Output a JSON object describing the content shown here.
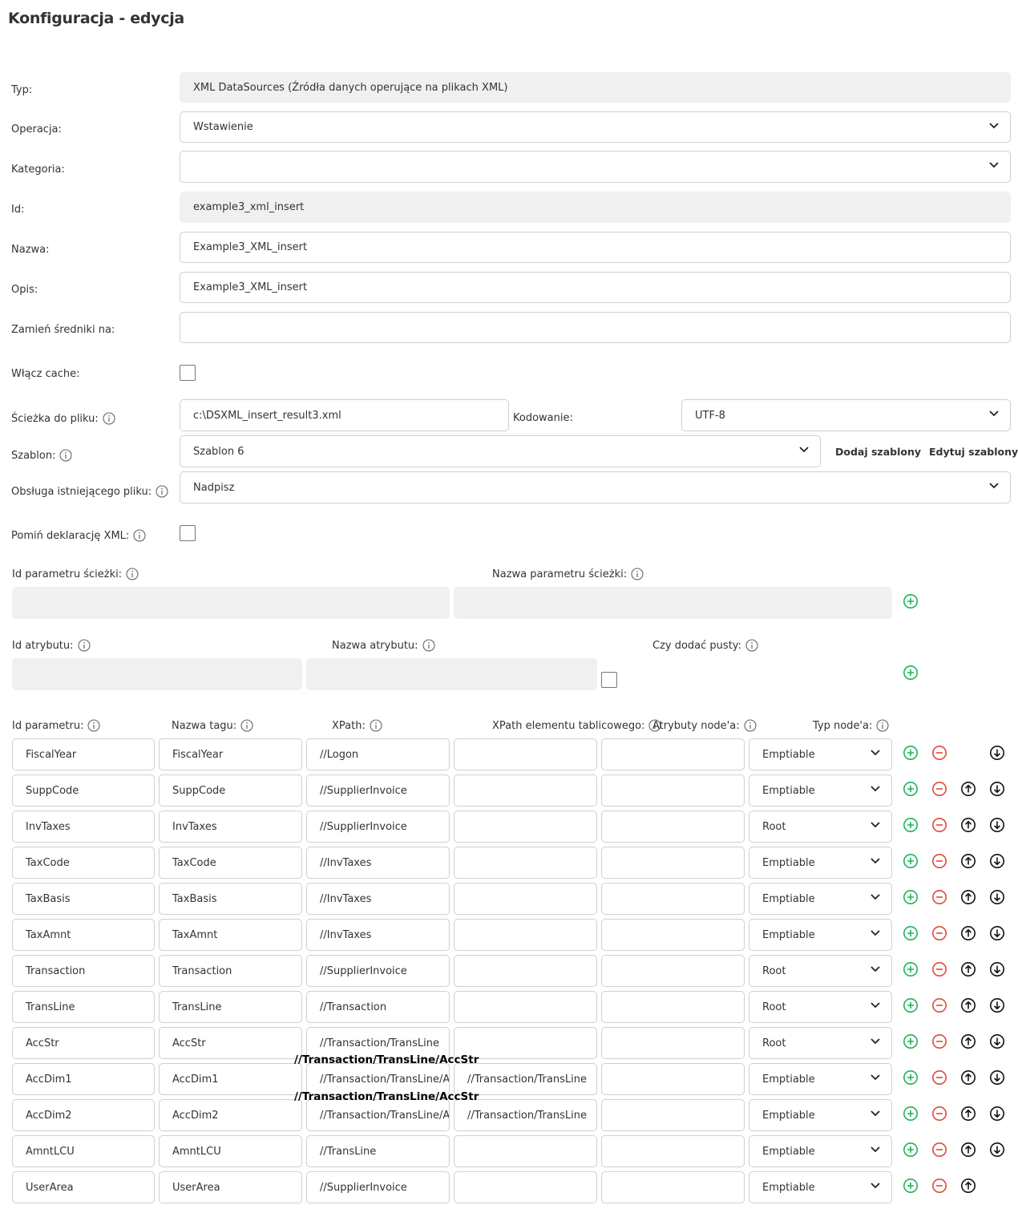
{
  "page": {
    "title": "Konfiguracja - edycja"
  },
  "form": {
    "typ": {
      "label": "Typ:",
      "value": "XML DataSources (Źródła danych operujące na plikach XML)"
    },
    "operacja": {
      "label": "Operacja:",
      "value": "Wstawienie"
    },
    "kategoria": {
      "label": "Kategoria:",
      "value": ""
    },
    "id": {
      "label": "Id:",
      "value": "example3_xml_insert"
    },
    "nazwa": {
      "label": "Nazwa:",
      "value": "Example3_XML_insert"
    },
    "opis": {
      "label": "Opis:",
      "value": "Example3_XML_insert"
    },
    "zamien": {
      "label": "Zamień średniki na:",
      "value": ""
    },
    "cache": {
      "label": "Włącz cache:",
      "checked": false
    },
    "sciezka": {
      "label": "Ścieżka do pliku:",
      "value": "c:\\DSXML_insert_result3.xml"
    },
    "kodowanie": {
      "label": "Kodowanie:",
      "value": "UTF-8"
    },
    "szablon": {
      "label": "Szablon:",
      "value": "Szablon 6",
      "add_label": "Dodaj szablony",
      "edit_label": "Edytuj szablony"
    },
    "obsluga": {
      "label": "Obsługa istniejącego pliku:",
      "value": "Nadpisz"
    },
    "pomin": {
      "label": "Pomiń deklarację XML:",
      "checked": false
    }
  },
  "path_params": {
    "id_label": "Id parametru ścieżki:",
    "name_label": "Nazwa parametru ścieżki:",
    "id_value": "",
    "name_value": ""
  },
  "attributes": {
    "id_label": "Id atrybutu:",
    "name_label": "Nazwa atrybutu:",
    "empty_label": "Czy dodać pusty:",
    "id_value": "",
    "name_value": "",
    "empty_checked": false
  },
  "params_table": {
    "headers": {
      "id": "Id parametru:",
      "tag": "Nazwa tagu:",
      "xpath": "XPath:",
      "xpath_array": "XPath elementu tablicowego:",
      "attrs": "Atrybuty node'a:",
      "type": "Typ node'a:"
    },
    "rows": [
      {
        "id": "FiscalYear",
        "tag": "FiscalYear",
        "xpath": "//Logon",
        "xpath_array": "",
        "attrs": "",
        "type": "Emptiable"
      },
      {
        "id": "SuppCode",
        "tag": "SuppCode",
        "xpath": "//SupplierInvoice",
        "xpath_array": "",
        "attrs": "",
        "type": "Emptiable"
      },
      {
        "id": "InvTaxes",
        "tag": "InvTaxes",
        "xpath": "//SupplierInvoice",
        "xpath_array": "",
        "attrs": "",
        "type": "Root"
      },
      {
        "id": "TaxCode",
        "tag": "TaxCode",
        "xpath": "//InvTaxes",
        "xpath_array": "",
        "attrs": "",
        "type": "Emptiable"
      },
      {
        "id": "TaxBasis",
        "tag": "TaxBasis",
        "xpath": "//InvTaxes",
        "xpath_array": "",
        "attrs": "",
        "type": "Emptiable"
      },
      {
        "id": "TaxAmnt",
        "tag": "TaxAmnt",
        "xpath": "//InvTaxes",
        "xpath_array": "",
        "attrs": "",
        "type": "Emptiable"
      },
      {
        "id": "Transaction",
        "tag": "Transaction",
        "xpath": "//SupplierInvoice",
        "xpath_array": "",
        "attrs": "",
        "type": "Root"
      },
      {
        "id": "TransLine",
        "tag": "TransLine",
        "xpath": "//Transaction",
        "xpath_array": "",
        "attrs": "",
        "type": "Root"
      },
      {
        "id": "AccStr",
        "tag": "AccStr",
        "xpath": "//Transaction/TransLine",
        "xpath_array": "",
        "attrs": "",
        "type": "Root"
      },
      {
        "id": "AccDim1",
        "tag": "AccDim1",
        "xpath": "//Transaction/TransLine/A",
        "xpath_array": "//Transaction/TransLine",
        "attrs": "",
        "type": "Emptiable"
      },
      {
        "id": "AccDim2",
        "tag": "AccDim2",
        "xpath": "//Transaction/TransLine/A",
        "xpath_array": "//Transaction/TransLine",
        "attrs": "",
        "type": "Emptiable"
      },
      {
        "id": "AmntLCU",
        "tag": "AmntLCU",
        "xpath": "//TransLine",
        "xpath_array": "",
        "attrs": "",
        "type": "Emptiable"
      },
      {
        "id": "UserArea",
        "tag": "UserArea",
        "xpath": "//SupplierInvoice",
        "xpath_array": "",
        "attrs": "",
        "type": "Emptiable"
      }
    ],
    "tooltips": [
      {
        "text": "//Transaction/TransLine/AccStr"
      },
      {
        "text": "//Transaction/TransLine/AccStr"
      }
    ]
  },
  "colors": {
    "add": "#1cb45a",
    "remove": "#e04a3a",
    "move": "#111111"
  },
  "icons": {
    "add": "plus-circle-icon",
    "remove": "minus-circle-icon",
    "up": "arrow-up-circle-icon",
    "down": "arrow-down-circle-icon",
    "info": "info-icon",
    "chevron": "chevron-down-icon"
  }
}
